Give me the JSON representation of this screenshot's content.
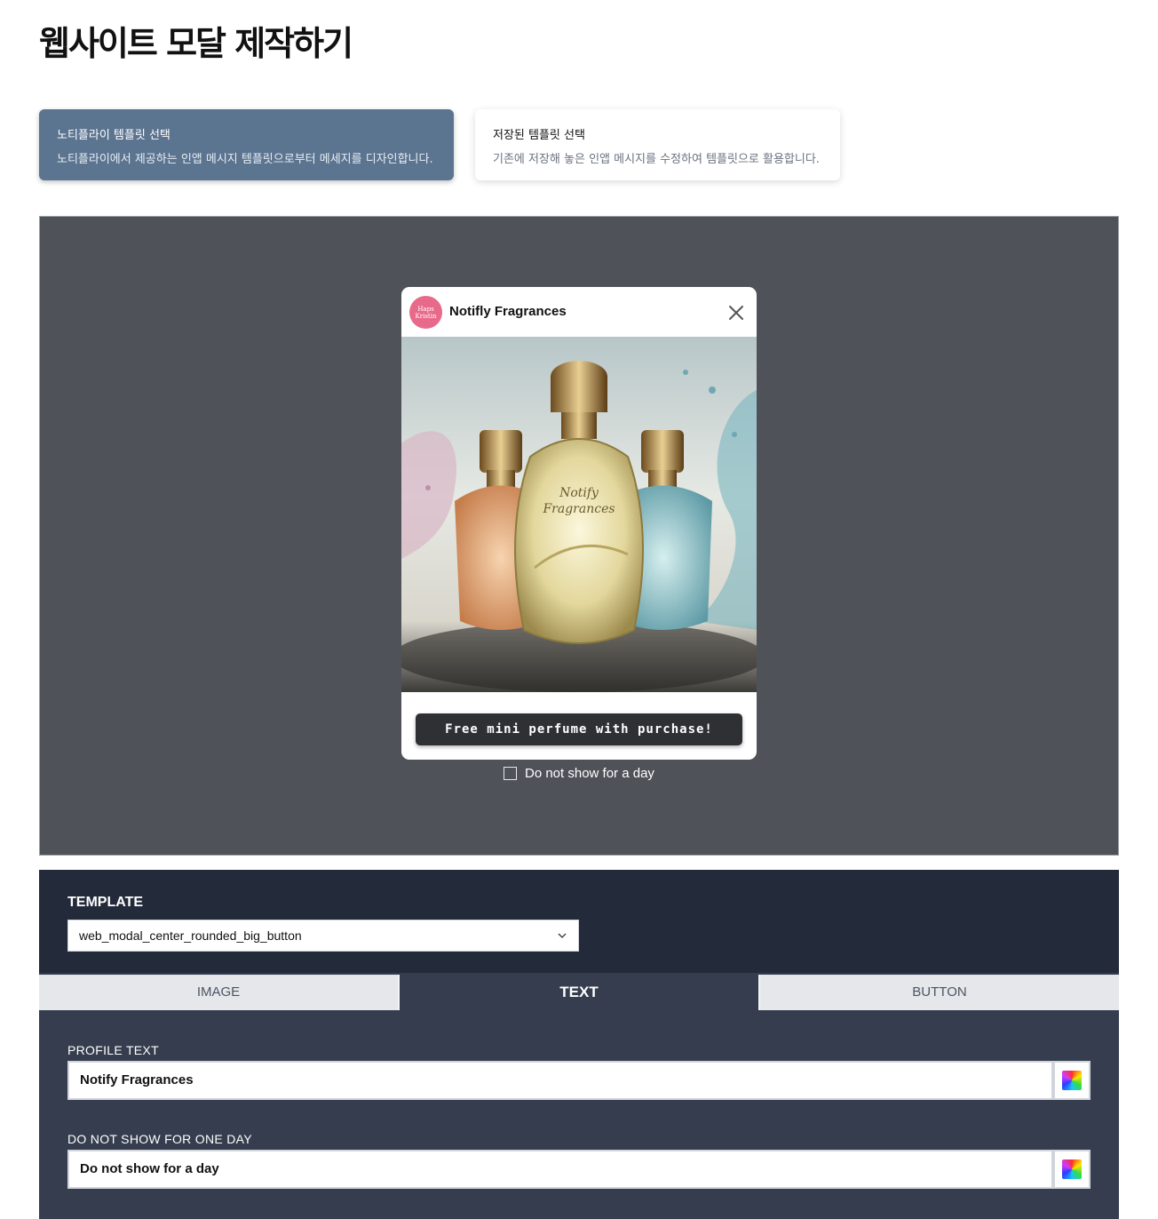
{
  "page": {
    "title": "웹사이트 모달 제작하기"
  },
  "template_cards": [
    {
      "title": "노티플라이 템플릿 선택",
      "description": "노티플라이에서 제공하는 인앱 메시지 템플릿으로부터 메세지를 디자인합니다."
    },
    {
      "title": "저장된 템플릿 선택",
      "description": "기존에 저장해 놓은 인앱 메시지를 수정하여 템플릿으로 활용합니다."
    }
  ],
  "preview": {
    "avatar_text": "Haps Kristin",
    "profile_name": "Notifly Fragrances",
    "image_bottle_labels": [
      "Notify",
      "Fragrances"
    ],
    "cta_label": "Free mini perfume with purchase!",
    "dont_show_label": "Do not show for a day",
    "colors": {
      "backdrop": "#4f5259",
      "cta": "#2f3033",
      "avatar": "#e86a8a"
    }
  },
  "editor": {
    "template_label": "TEMPLATE",
    "template_value": "web_modal_center_rounded_big_button",
    "tabs": [
      {
        "label": "IMAGE",
        "active": false
      },
      {
        "label": "TEXT",
        "active": true
      },
      {
        "label": "BUTTON",
        "active": false
      }
    ],
    "fields": [
      {
        "label": "PROFILE TEXT",
        "value": "Notify Fragrances"
      },
      {
        "label": "DO NOT SHOW FOR ONE DAY",
        "value": "Do not show for a day"
      }
    ]
  }
}
